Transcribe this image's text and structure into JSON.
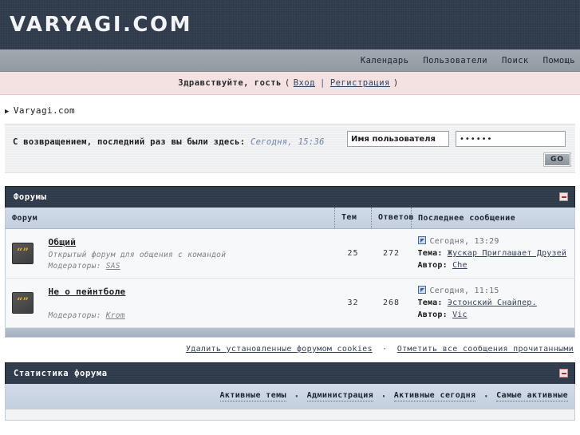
{
  "site": {
    "logo": "VARYAGI.COM"
  },
  "nav": {
    "items": [
      {
        "label": "Календарь",
        "name": "nav-calendar"
      },
      {
        "label": "Пользователи",
        "name": "nav-members"
      },
      {
        "label": "Поиск",
        "name": "nav-search"
      },
      {
        "label": "Помощь",
        "name": "nav-help"
      }
    ]
  },
  "greeting": {
    "text": "Здравствуйте, гость",
    "open_paren": "(",
    "login_label": "Вход",
    "divider": "|",
    "register_label": "Регистрация",
    "close_paren": ")"
  },
  "breadcrumb": {
    "arrow": "▶",
    "root": "Varyagi.com"
  },
  "welcome": {
    "text": "С возвращением, последний раз вы были здесь:",
    "date": "Сегодня, 15:36"
  },
  "login": {
    "username_value": "Имя пользователя",
    "username_placeholder": "Имя пользователя",
    "password_value": "••••••",
    "submit_label": "GO"
  },
  "forums_panel": {
    "title": "Форумы",
    "collapse_name": "collapse-icon",
    "columns": {
      "forum": "Форум",
      "topics": "Тем",
      "replies": "Ответов",
      "last_post": "Последнее сообщение"
    },
    "rows": [
      {
        "icon": "forum-quote-icon",
        "name": "Общий",
        "description": "Открытый форум для общения с командой",
        "moderators_label": "Модераторы:",
        "moderators": "SAS",
        "topics": "25",
        "replies": "272",
        "last_date": "Сегодня, 13:29",
        "topic_label": "Тема:",
        "topic": "Жускар Приглашает Друзей",
        "author_label": "Автор:",
        "author": "Che"
      },
      {
        "icon": "forum-quote-icon",
        "name": "Не о пейнтболе",
        "description": "",
        "moderators_label": "Модераторы:",
        "moderators": "Krom",
        "topics": "32",
        "replies": "268",
        "last_date": "Сегодня, 11:15",
        "topic_label": "Тема:",
        "topic": "Эстонский Снайпер.",
        "author_label": "Автор:",
        "author": "Vic"
      }
    ]
  },
  "subnav": {
    "delete_cookies": "Удалить установленные форумом cookies",
    "separator": "·",
    "mark_read": "Отметить все сообщения прочитанными"
  },
  "stats_panel": {
    "title": "Статистика форума",
    "links": [
      {
        "label": "Активные темы",
        "name": "stat-link-active-topics"
      },
      {
        "label": "Администрация",
        "name": "stat-link-administration"
      },
      {
        "label": "Активные сегодня",
        "name": "stat-link-active-today"
      },
      {
        "label": "Самые активные",
        "name": "stat-link-top-posters"
      }
    ],
    "separator": "·"
  },
  "colors": {
    "header_dark": "#2f3a4a",
    "nav_gray": "#9aa0a8",
    "greeting_pink": "#f4e2e2",
    "table_header_blue": "#ccd6e4",
    "link_blue": "#36415a",
    "icon_yellow": "#f0b020"
  }
}
